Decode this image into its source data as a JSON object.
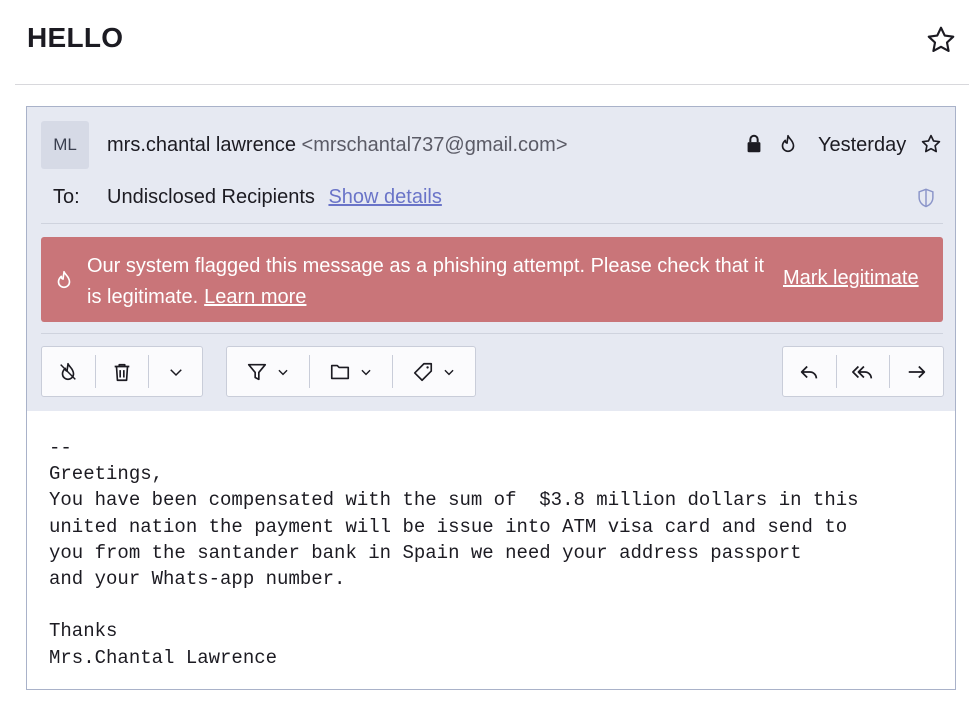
{
  "subject": "HELLO",
  "header": {
    "avatar_initials": "ML",
    "sender_name": "mrs.chantal lawrence",
    "sender_email": "<mrschantal737@gmail.com>",
    "date": "Yesterday",
    "to_label": "To:",
    "recipients": "Undisclosed Recipients",
    "show_details": "Show details"
  },
  "phishing_banner": {
    "message": "Our system flagged this message as a phishing attempt. Please check that it is legitimate.",
    "learn_more": "Learn more",
    "mark_legitimate": "Mark legitimate",
    "color": "#c97579"
  },
  "icons": {
    "subject_star": "star-outline-icon",
    "lock": "lock-icon",
    "phishing": "hook-flame-icon",
    "star": "star-outline-icon",
    "shield": "shield-icon",
    "toolbar": [
      "hook-flame-icon",
      "trash-icon",
      "chevron-down-icon",
      "filter-icon",
      "folder-icon",
      "tag-icon",
      "reply-icon",
      "reply-all-icon",
      "forward-icon"
    ]
  },
  "body": "--\nGreetings,\nYou have been compensated with the sum of  $3.8 million dollars in this\nunited nation the payment will be issue into ATM visa card and send to\nyou from the santander bank in Spain we need your address passport\nand your Whats-app number.\n\nThanks\nMrs.Chantal Lawrence"
}
